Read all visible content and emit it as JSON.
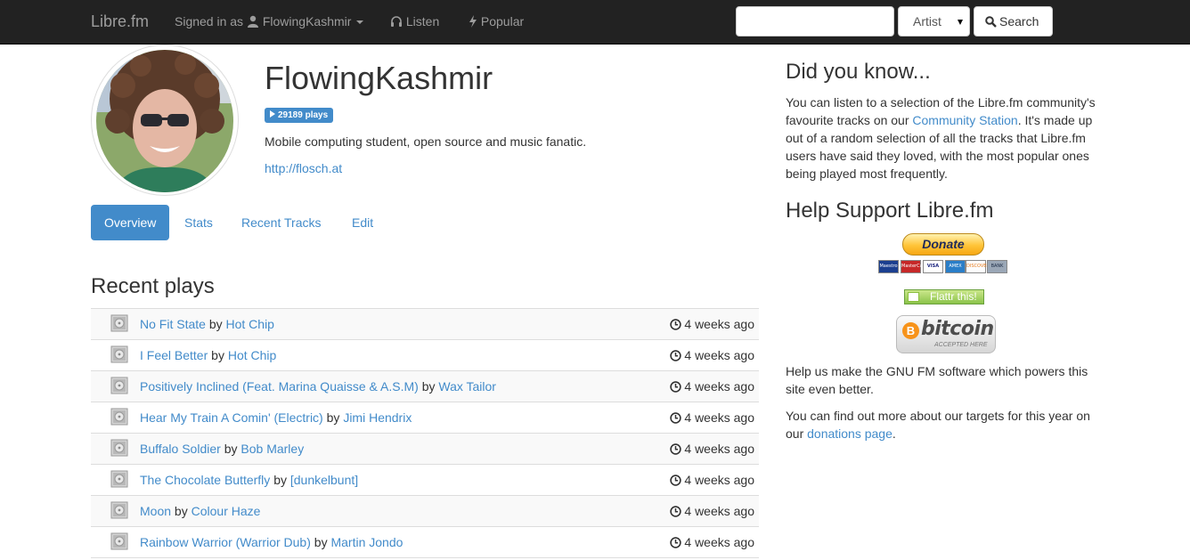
{
  "navbar": {
    "brand": "Libre.fm",
    "signed_in_prefix": "Signed in as",
    "username": "FlowingKashmir",
    "listen": "Listen",
    "popular": "Popular",
    "search_placeholder": "",
    "search_type": "Artist",
    "search_button": "Search"
  },
  "profile": {
    "name": "FlowingKashmir",
    "plays": "29189 plays",
    "bio": "Mobile computing student, open source and music fanatic.",
    "homepage": "http://flosch.at"
  },
  "tabs": [
    "Overview",
    "Stats",
    "Recent Tracks",
    "Edit"
  ],
  "recent": {
    "title": "Recent plays",
    "by": "by",
    "items": [
      {
        "track": "No Fit State",
        "artist": "Hot Chip",
        "time": "4 weeks ago"
      },
      {
        "track": "I Feel Better",
        "artist": "Hot Chip",
        "time": "4 weeks ago"
      },
      {
        "track": "Positively Inclined (Feat. Marina Quaisse & A.S.M)",
        "artist": "Wax Tailor",
        "time": "4 weeks ago"
      },
      {
        "track": "Hear My Train A Comin' (Electric)",
        "artist": "Jimi Hendrix",
        "time": "4 weeks ago"
      },
      {
        "track": "Buffalo Soldier",
        "artist": "Bob Marley",
        "time": "4 weeks ago"
      },
      {
        "track": "The Chocolate Butterfly",
        "artist": "[dunkelbunt]",
        "time": "4 weeks ago"
      },
      {
        "track": "Moon",
        "artist": "Colour Haze",
        "time": "4 weeks ago"
      },
      {
        "track": "Rainbow Warrior (Warrior Dub)",
        "artist": "Martin Jondo",
        "time": "4 weeks ago"
      }
    ]
  },
  "sidebar": {
    "did_you_know_title": "Did you know...",
    "did_you_know_pre": "You can listen to a selection of the Libre.fm community's favourite tracks on our",
    "community_station": "Community Station",
    "did_you_know_post": ". It's made up out of a random selection of all the tracks that Libre.fm users have said they loved, with the most popular ones being played most frequently.",
    "support_title": "Help Support Libre.fm",
    "donate_label": "Donate",
    "cards": [
      "Maestro",
      "MasterCard",
      "VISA",
      "AMEX",
      "DISCOVER",
      "BANK"
    ],
    "flattr_label": "Flattr this!",
    "bitcoin_word": "bitcoin",
    "bitcoin_sub": "ACCEPTED HERE",
    "help_text": "Help us make the GNU FM software which powers this site even better.",
    "targets_pre": "You can find out more about our targets for this year on our",
    "donations_link": "donations page",
    "targets_post": "."
  }
}
